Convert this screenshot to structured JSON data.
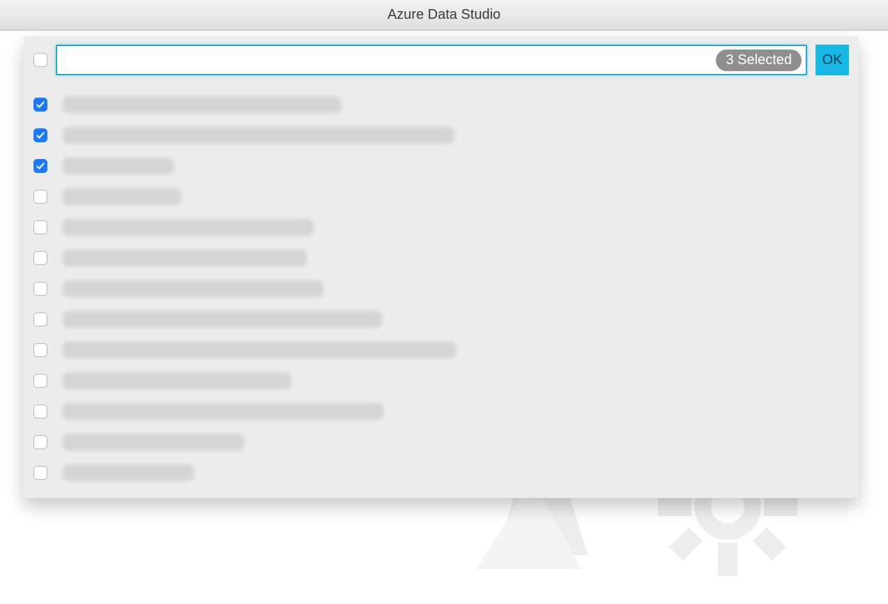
{
  "window": {
    "title": "Azure Data Studio"
  },
  "picker": {
    "select_all_checked": false,
    "search_value": "",
    "selected_count_label": "3 Selected",
    "ok_label": "OK",
    "items": [
      {
        "checked": true,
        "label": "(redacted)",
        "blur_width": 400
      },
      {
        "checked": true,
        "label": "(redacted)",
        "blur_width": 562
      },
      {
        "checked": true,
        "label": "(redacted)",
        "blur_width": 160
      },
      {
        "checked": false,
        "label": "(redacted)",
        "blur_width": 170
      },
      {
        "checked": false,
        "label": "(redacted)",
        "blur_width": 360
      },
      {
        "checked": false,
        "label": "(redacted)",
        "blur_width": 350
      },
      {
        "checked": false,
        "label": "(redacted)",
        "blur_width": 374
      },
      {
        "checked": false,
        "label": "(redacted)",
        "blur_width": 458
      },
      {
        "checked": false,
        "label": "(redacted)",
        "blur_width": 564
      },
      {
        "checked": false,
        "label": "(redacted)",
        "blur_width": 328
      },
      {
        "checked": false,
        "label": "(redacted)",
        "blur_width": 460
      },
      {
        "checked": false,
        "label": "(redacted)",
        "blur_width": 260
      },
      {
        "checked": false,
        "label": "(redacted)",
        "blur_width": 188
      }
    ]
  }
}
